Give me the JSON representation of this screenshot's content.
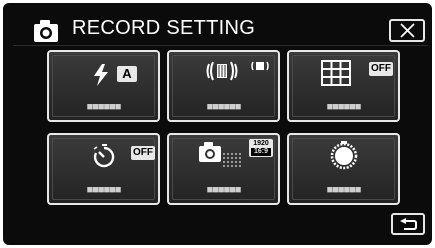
{
  "header": {
    "title": "RECORD SETTING",
    "camera_icon": "camera-icon",
    "close_icon": "close-icon"
  },
  "tiles": [
    {
      "icon": "flash-icon",
      "badge": "A",
      "label": "■■■■■■"
    },
    {
      "icon": "image-stabilizer-icon",
      "label": "■■■■■■"
    },
    {
      "icon": "grid-icon",
      "badge": "OFF",
      "label": "■■■■■■"
    },
    {
      "icon": "self-timer-icon",
      "badge": "OFF",
      "label": "■■■■■■"
    },
    {
      "icon": "photo-size-icon",
      "badge_top": "1920",
      "badge_bottom": "16:9",
      "label": "■■■■■■"
    },
    {
      "icon": "shutter-dial-icon",
      "label": "■■■■■■"
    }
  ],
  "footer": {
    "back_icon": "back-arrow-icon"
  },
  "colors": {
    "background": "#0b0b0b",
    "tile": "#333333",
    "border": "#e8e8e8",
    "text": "#ffffff"
  }
}
